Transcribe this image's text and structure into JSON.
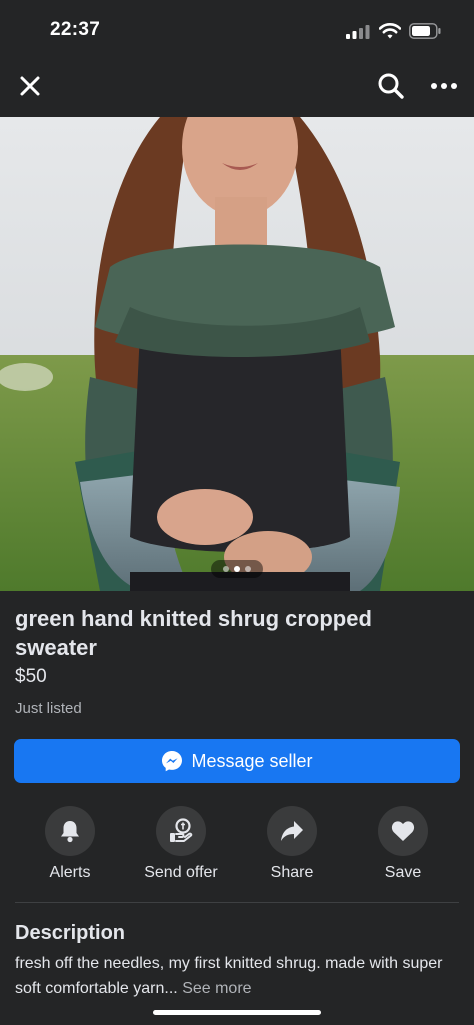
{
  "status_bar": {
    "time": "22:37"
  },
  "listing": {
    "title": "green hand knitted shrug cropped sweater",
    "price": "$50",
    "listed": "Just listed",
    "photo_page": 1,
    "photo_count": 3
  },
  "message_button": {
    "label": "Message seller"
  },
  "actions": [
    {
      "label": "Alerts",
      "icon": "bell-icon"
    },
    {
      "label": "Send offer",
      "icon": "offer-icon"
    },
    {
      "label": "Share",
      "icon": "share-icon"
    },
    {
      "label": "Save",
      "icon": "heart-icon"
    }
  ],
  "description": {
    "heading": "Description",
    "text": "fresh off the needles, my first knitted shrug. made with super soft comfortable yarn...",
    "see_more": "See more"
  },
  "colors": {
    "background": "#242526",
    "primary_button": "#1877f2",
    "action_circle": "#3a3b3c",
    "secondary_text": "#b0b3b8"
  }
}
